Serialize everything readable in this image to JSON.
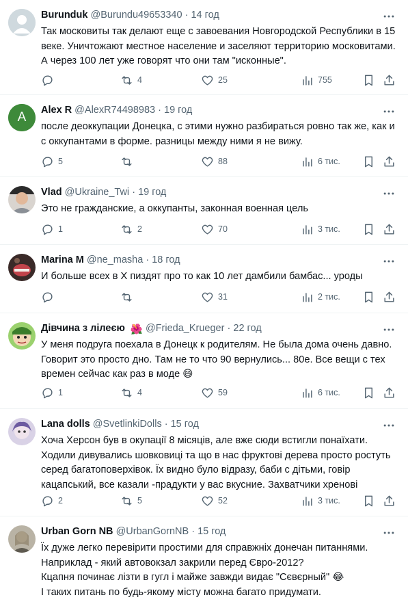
{
  "tweets": [
    {
      "name": "Burunduk",
      "handle": "@Burundu49653340",
      "time": "14 год",
      "text": "Так московиты так делают еще с завоевания Новгородской Республики в 15 веке. Уничтожают местное население и заселяют территорию московитами. А через 100 лет уже говорят что они там \"исконные\".",
      "replies": "",
      "retweets": "4",
      "likes": "25",
      "views": "755",
      "avatar": "default-avatar"
    },
    {
      "name": "Alex R",
      "handle": "@AlexR74498983",
      "time": "19 год",
      "text": "после деоккупации Донецка, с этими нужно разбираться ровно так же, как и с оккупантами в форме. разницы между ними я не вижу.",
      "replies": "5",
      "retweets": "",
      "likes": "88",
      "views": "6 тис.",
      "avatar_letter": "A",
      "avatar_color": "#3e8a3a"
    },
    {
      "name": "Vlad",
      "handle": "@Ukraine_Twi",
      "time": "19 год",
      "text": "Это не гражданские, а оккупанты, законная военная цель",
      "replies": "1",
      "retweets": "2",
      "likes": "70",
      "views": "3 тис.",
      "avatar": "photo-avatar"
    },
    {
      "name": "Marina M",
      "handle": "@ne_masha",
      "time": "18 год",
      "text": "И больше всех в X пиздят про то как 10 лет дамбили бамбас... уроды",
      "replies": "",
      "retweets": "",
      "likes": "31",
      "views": "2 тис.",
      "avatar": "photo-avatar"
    },
    {
      "name": "Дівчина з лілеєю",
      "handle": "@Frieda_Krueger",
      "time": "22 год",
      "text": "У меня подруга поехала в Донецк к родителям. Не была дома очень давно. Говорит это просто дно. Там не то что 90 вернулись... 80е. Все вещи с тех времен сейчас как раз в моде 😄",
      "replies": "1",
      "retweets": "4",
      "likes": "59",
      "views": "6 тис.",
      "avatar": "cartoon-avatar",
      "name_badge": "🌺"
    },
    {
      "name": "Lana dolls",
      "handle": "@SvetlinkiDolls",
      "time": "15 год",
      "text": "Хоча Херсон був в окупації 8 місяців, але вже сюди встигли понаїхати.\nХодили дивувались шовковиці та що в нас фруктові дерева просто ростуть серед багатоповерхівок. Їх видно було відразу, баби с дітьми, говір кацапський, все казали -прадукти у вас вкусние. Захватчики хренові",
      "replies": "2",
      "retweets": "5",
      "likes": "52",
      "views": "3 тис.",
      "avatar": "doll-avatar"
    },
    {
      "name": "Urban Gorn NB",
      "handle": "@UrbanGornNB",
      "time": "15 год",
      "text": "Їх дуже легко перевірити простими для справжніх донечан питаннями.\nНаприклад - який автовокзал закрили перед Євро-2012?\nКцапня починає лізти в гугл і майже завжди видає \"Сєвєрный\" 😂\nІ таких питань по будь-якому місту можна багато придумати.",
      "replies": "",
      "retweets": "",
      "likes": "",
      "views": "",
      "avatar": "photo-avatar"
    }
  ],
  "icons": {
    "reply": "reply-icon",
    "retweet": "retweet-icon",
    "like": "like-icon",
    "views": "views-icon",
    "bookmark": "bookmark-icon",
    "share": "share-icon",
    "more": "more-icon"
  },
  "colors": {
    "text": "#0f1419",
    "secondary": "#536471",
    "divider": "#eff3f4"
  }
}
